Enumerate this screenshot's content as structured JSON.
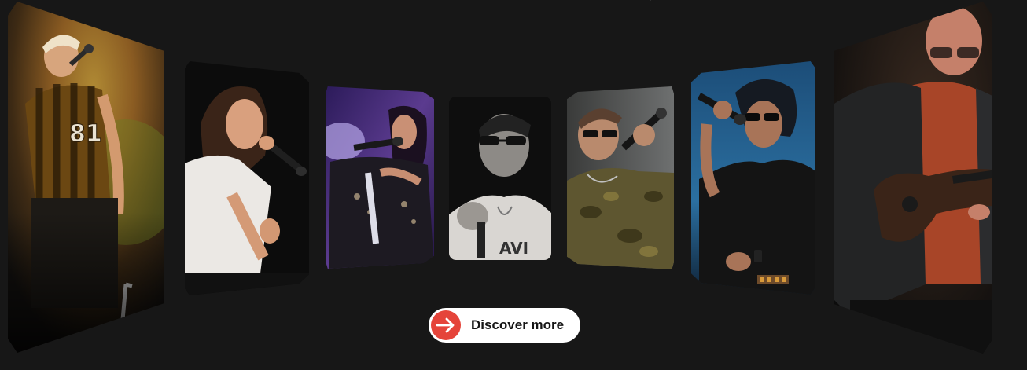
{
  "headline": {
    "fragment": "..."
  },
  "carousel": {
    "cards": [
      {
        "id": "card-1",
        "subject": "performer in striped jersey singing",
        "accent": "#b9862b"
      },
      {
        "id": "card-2",
        "subject": "performer in white t-shirt singing",
        "accent": "#d9d5cf"
      },
      {
        "id": "card-3",
        "subject": "performer on purple-lit stage",
        "accent": "#5b3b8f"
      },
      {
        "id": "card-4",
        "subject": "performer in sunglasses black and white",
        "accent": "#9a9a9a"
      },
      {
        "id": "card-5",
        "subject": "performer in camouflage jacket",
        "accent": "#5e5630"
      },
      {
        "id": "card-6",
        "subject": "performer in sunglasses on blue stage",
        "accent": "#2b6fa0"
      },
      {
        "id": "card-7",
        "subject": "guitarist in red light",
        "accent": "#a84528"
      }
    ]
  },
  "cta": {
    "label": "Discover more",
    "icon": "arrow-right-icon",
    "button_color": "#ffffff",
    "icon_color": "#e5443a"
  }
}
